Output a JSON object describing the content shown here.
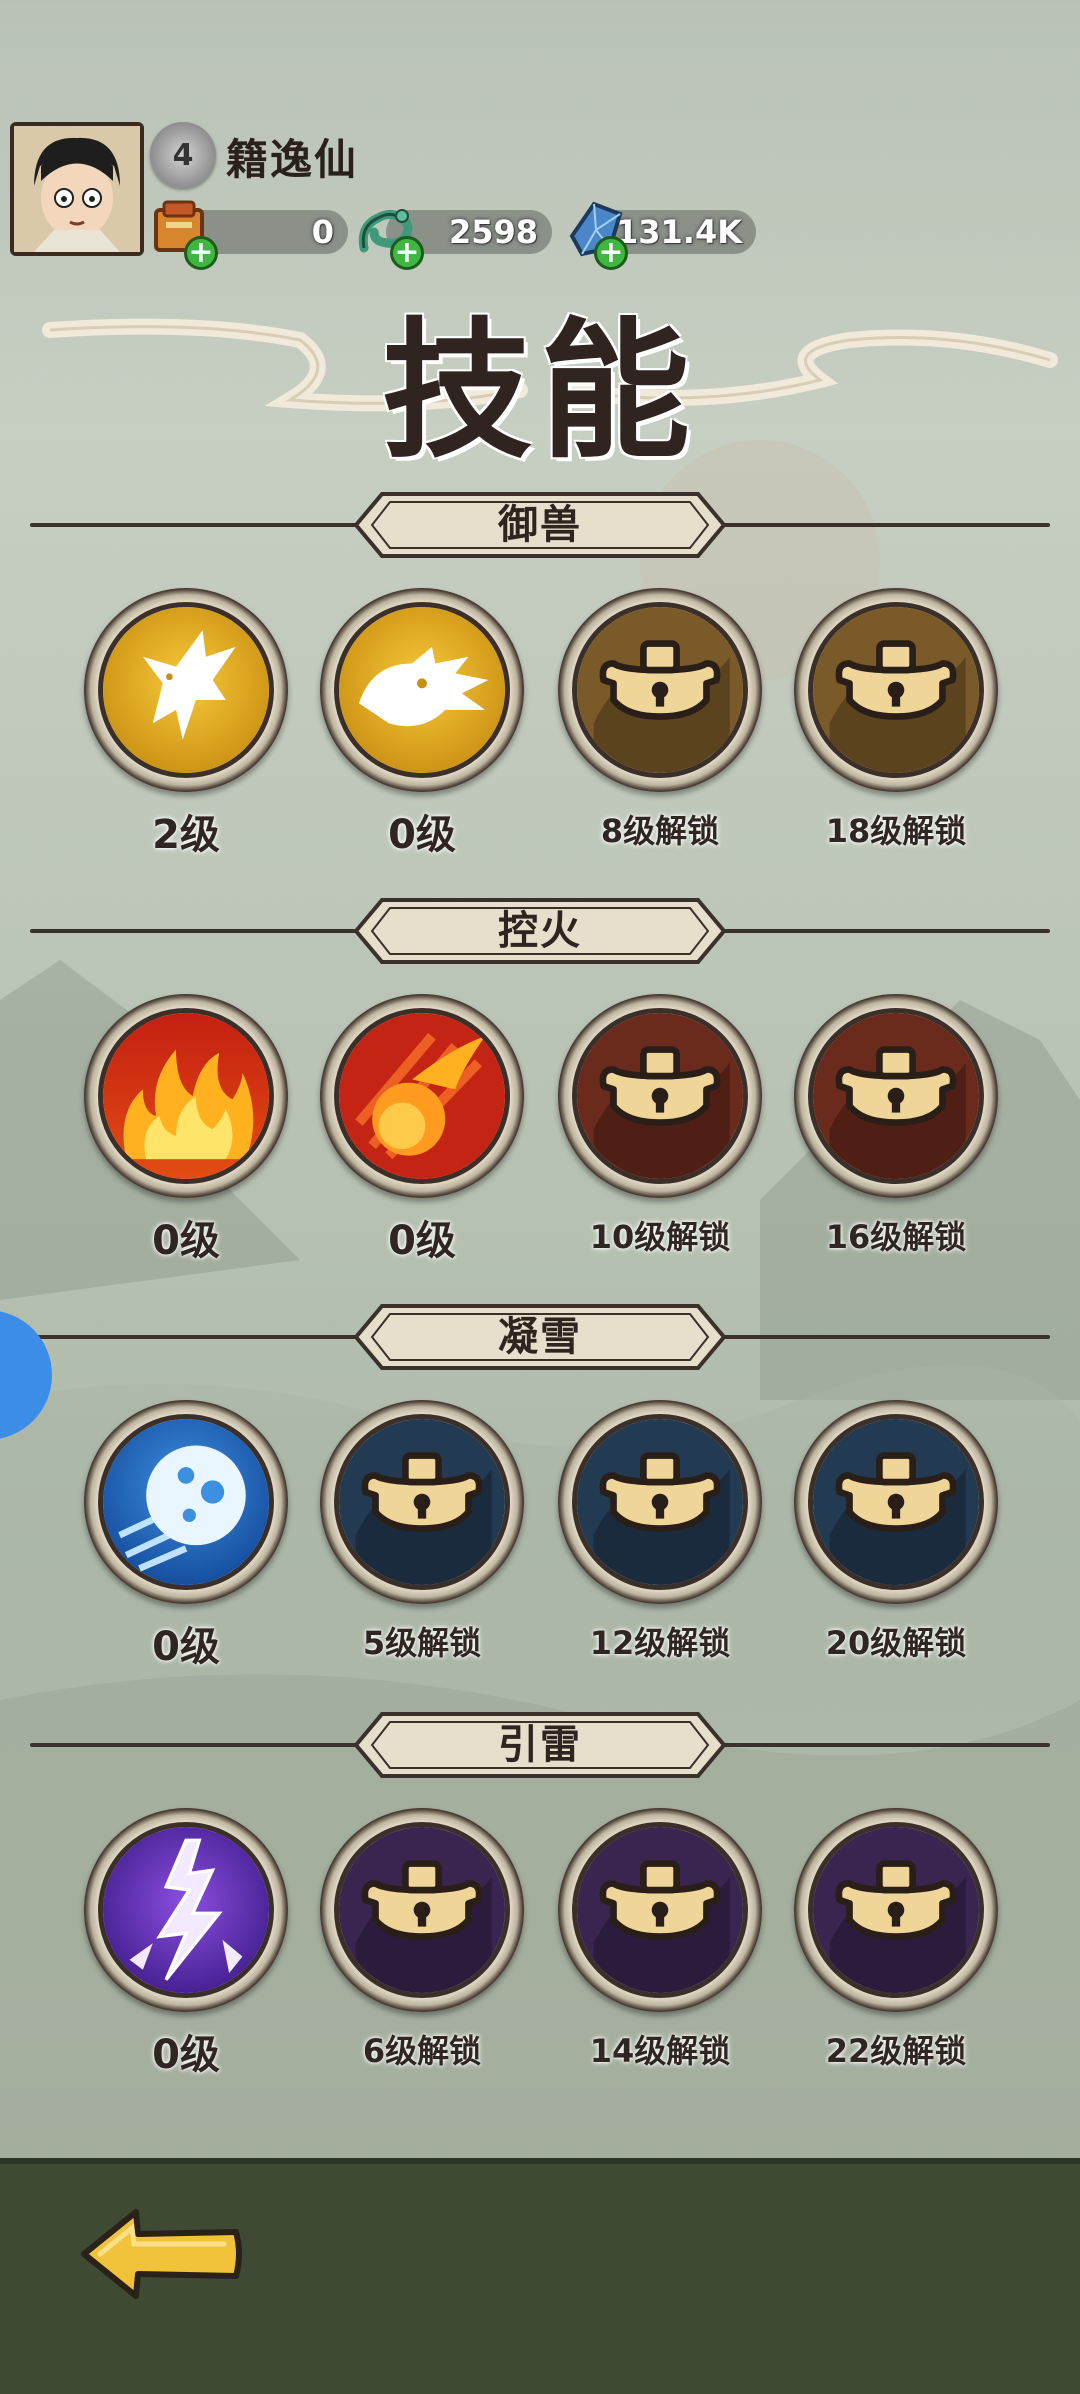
{
  "player": {
    "name": "籍逸仙",
    "level": "4"
  },
  "resources": [
    {
      "name": "scroll",
      "icon": "scroll-icon",
      "value": "0"
    },
    {
      "name": "jade",
      "icon": "jade-dragon-icon",
      "value": "2598"
    },
    {
      "name": "crystal",
      "icon": "crystal-icon",
      "value": "131.4K"
    }
  ],
  "title": "技能",
  "sections": [
    {
      "name": "御兽",
      "theme": "#7a5a28",
      "slots": [
        {
          "label": "2级",
          "locked": false,
          "icon": "eagle-icon"
        },
        {
          "label": "0级",
          "locked": false,
          "icon": "dragon-head-icon"
        },
        {
          "label": "8级解锁",
          "locked": true,
          "icon": "lock-icon"
        },
        {
          "label": "18级解锁",
          "locked": true,
          "icon": "lock-icon"
        }
      ]
    },
    {
      "name": "控火",
      "theme": "#6a2a1c",
      "slots": [
        {
          "label": "0级",
          "locked": false,
          "icon": "flame-icon"
        },
        {
          "label": "0级",
          "locked": false,
          "icon": "fireball-icon"
        },
        {
          "label": "10级解锁",
          "locked": true,
          "icon": "lock-icon"
        },
        {
          "label": "16级解锁",
          "locked": true,
          "icon": "lock-icon"
        }
      ]
    },
    {
      "name": "凝雪",
      "theme": "#223a52",
      "slots": [
        {
          "label": "0级",
          "locked": false,
          "icon": "snowball-icon"
        },
        {
          "label": "5级解锁",
          "locked": true,
          "icon": "lock-icon"
        },
        {
          "label": "12级解锁",
          "locked": true,
          "icon": "lock-icon"
        },
        {
          "label": "20级解锁",
          "locked": true,
          "icon": "lock-icon"
        }
      ]
    },
    {
      "name": "引雷",
      "theme": "#3a2450",
      "slots": [
        {
          "label": "0级",
          "locked": false,
          "icon": "lightning-icon"
        },
        {
          "label": "6级解锁",
          "locked": true,
          "icon": "lock-icon"
        },
        {
          "label": "14级解锁",
          "locked": true,
          "icon": "lock-icon"
        },
        {
          "label": "22级解锁",
          "locked": true,
          "icon": "lock-icon"
        }
      ]
    }
  ],
  "back_icon": "back-arrow-icon"
}
